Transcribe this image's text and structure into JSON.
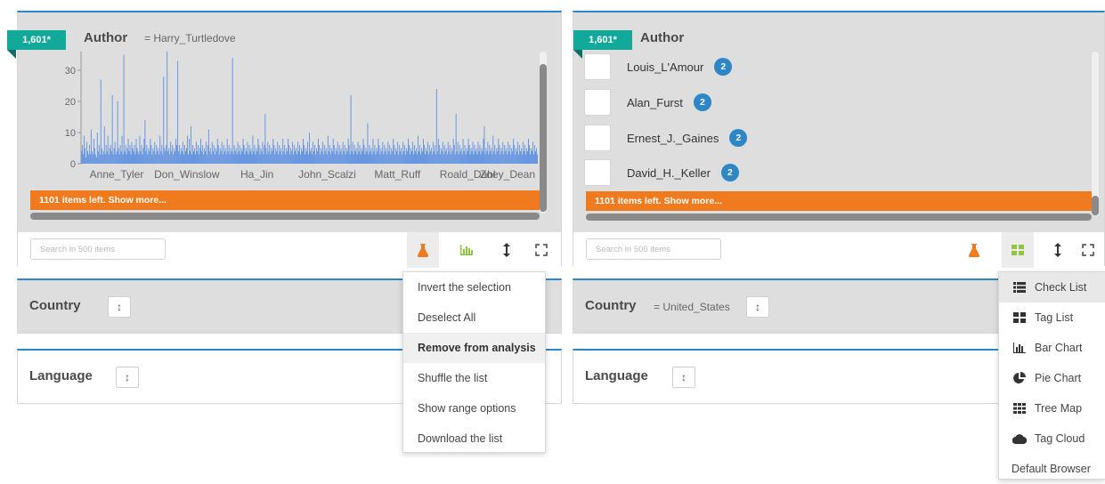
{
  "left_panel": {
    "count_badge": "1,601*",
    "title": "Author",
    "filter": "= Harry_Turtledove",
    "show_more": "1101 items left. Show more...",
    "search_placeholder": "Search in 500 items"
  },
  "right_panel": {
    "count_badge": "1,601*",
    "title": "Author",
    "items": [
      {
        "label": "Louis_L'Amour",
        "count": "2"
      },
      {
        "label": "Alan_Furst",
        "count": "2"
      },
      {
        "label": "Ernest_J._Gaines",
        "count": "2"
      },
      {
        "label": "David_H._Keller",
        "count": "2"
      }
    ],
    "show_more": "1101 items left. Show more...",
    "search_placeholder": "Search in 500 items"
  },
  "country_left": {
    "title": "Country",
    "sort_icon": "↕"
  },
  "language_left": {
    "title": "Language",
    "sort_icon": "↕"
  },
  "country_right": {
    "title": "Country",
    "filter": "= United_States",
    "sort_icon": "↕"
  },
  "language_right": {
    "title": "Language",
    "sort_icon": "↕"
  },
  "settings_menu": {
    "items": [
      "Invert the selection",
      "Deselect All",
      "Remove from analysis",
      "Shuffle the list",
      "Show range options",
      "Download the list"
    ]
  },
  "view_menu": {
    "items": [
      {
        "label": "Check List",
        "icon": "check-list-icon"
      },
      {
        "label": "Tag List",
        "icon": "tag-list-icon"
      },
      {
        "label": "Bar Chart",
        "icon": "bar-chart-icon"
      },
      {
        "label": "Pie Chart",
        "icon": "pie-chart-icon"
      },
      {
        "label": "Tree Map",
        "icon": "tree-map-icon"
      },
      {
        "label": "Tag Cloud",
        "icon": "tag-cloud-icon"
      }
    ],
    "default_label": "Default Browser"
  },
  "colors": {
    "accent": "#2d87c6",
    "teal": "#12a99a",
    "orange": "#f07a1e",
    "bar": "#5b8fe0"
  },
  "chart_data": {
    "type": "bar",
    "ylim": [
      0,
      36
    ],
    "yticks": [
      "0",
      "10",
      "20",
      "30"
    ],
    "xticks": [
      "Anne_Tyler",
      "Don_Winslow",
      "Ha_Jin",
      "John_Scalzi",
      "Matt_Ruff",
      "Roald_Dahl",
      "Zoey_Dean"
    ],
    "values": [
      4,
      6,
      3,
      9,
      5,
      2,
      7,
      4,
      3,
      6,
      3,
      11,
      4,
      3,
      8,
      5,
      3,
      2,
      10,
      4,
      6,
      3,
      27,
      5,
      3,
      4,
      12,
      3,
      6,
      4,
      9,
      3,
      5,
      6,
      4,
      22,
      3,
      5,
      7,
      3,
      4,
      20,
      5,
      3,
      6,
      4,
      9,
      3,
      35,
      4,
      6,
      3,
      5,
      8,
      4,
      6,
      3,
      7,
      5,
      4,
      6,
      3,
      8,
      5,
      4,
      3,
      9,
      4,
      6,
      3,
      5,
      8,
      14,
      4,
      6,
      3,
      5,
      4,
      8,
      6,
      3,
      5,
      4,
      7,
      3,
      6,
      4,
      5,
      3,
      9,
      4,
      6,
      3,
      28,
      5,
      4,
      6,
      36,
      4,
      5,
      3,
      7,
      4,
      6,
      3,
      5,
      4,
      8,
      6,
      33,
      4,
      6,
      3,
      5,
      4,
      7,
      3,
      6,
      4,
      5,
      9,
      3,
      8,
      4,
      12,
      3,
      6,
      4,
      5,
      3,
      7,
      4,
      6,
      3,
      5,
      8,
      4,
      6,
      3,
      5,
      4,
      7,
      3,
      6,
      11,
      4,
      5,
      3,
      7,
      4,
      6,
      3,
      5,
      4,
      8,
      6,
      3,
      5,
      4,
      7,
      3,
      6,
      4,
      5,
      3,
      8,
      4,
      6,
      3,
      5,
      4,
      34,
      3,
      6,
      4,
      5,
      3,
      7,
      4,
      6,
      3,
      5,
      4,
      8,
      6,
      3,
      5,
      4,
      7,
      3,
      6,
      4,
      5,
      3,
      9,
      4,
      6,
      3,
      5,
      4,
      8,
      6,
      3,
      5,
      4,
      7,
      3,
      6,
      16,
      5,
      3,
      7,
      4,
      6,
      3,
      5,
      4,
      8,
      6,
      3,
      5,
      4,
      7,
      3,
      6,
      4,
      5,
      3,
      8,
      4,
      6,
      3,
      5,
      4,
      8,
      6,
      3,
      5,
      4,
      7,
      3,
      6,
      4,
      5,
      3,
      7,
      4,
      6,
      3,
      5,
      4,
      8,
      6,
      3,
      5,
      4,
      7,
      3,
      10,
      4,
      5,
      3,
      7,
      4,
      6,
      3,
      5,
      4,
      8,
      6,
      3,
      5,
      4,
      7,
      3,
      6,
      4,
      5,
      3,
      9,
      4,
      6,
      3,
      5,
      4,
      8,
      6,
      3,
      5,
      4,
      7,
      3,
      6,
      4,
      5,
      3,
      7,
      4,
      6,
      3,
      5,
      4,
      8,
      6,
      3,
      22,
      4,
      7,
      3,
      6,
      4,
      5,
      3,
      7,
      4,
      6,
      3,
      5,
      4,
      8,
      6,
      3,
      5,
      4,
      13,
      3,
      6,
      4,
      5,
      3,
      8,
      4,
      6,
      3,
      5,
      4,
      8,
      6,
      3,
      5,
      4,
      7,
      3,
      6,
      4,
      5,
      3,
      7,
      4,
      6,
      3,
      5,
      4,
      8,
      6,
      3,
      5,
      4,
      7,
      3,
      6,
      4,
      5,
      3,
      7,
      4,
      6,
      3,
      5,
      4,
      8,
      6,
      3,
      5,
      4,
      7,
      3,
      6,
      4,
      5,
      3,
      9,
      4,
      6,
      3,
      5,
      4,
      8,
      6,
      3,
      5,
      4,
      7,
      3,
      6,
      4,
      5,
      3,
      7,
      4,
      6,
      3,
      24,
      4,
      8,
      6,
      3,
      5,
      4,
      7,
      3,
      6,
      4,
      5,
      3,
      7,
      4,
      6,
      3,
      5,
      4,
      8,
      6,
      3,
      16,
      4,
      7,
      3,
      6,
      4,
      5,
      3,
      8,
      4,
      6,
      3,
      5,
      4,
      8,
      6,
      3,
      5,
      4,
      7,
      3,
      6,
      4,
      5,
      3,
      7,
      4,
      6,
      3,
      5,
      4,
      8,
      12,
      3,
      5,
      4,
      7,
      3,
      6,
      4,
      5,
      3,
      9,
      4,
      6,
      3,
      5,
      4,
      8,
      6,
      3,
      5,
      4,
      7,
      3,
      6,
      4,
      5,
      3,
      7,
      4,
      6,
      3,
      5,
      4,
      8,
      6,
      3,
      5,
      4,
      7,
      3,
      6,
      4,
      5,
      3,
      7,
      4,
      6,
      3,
      5,
      4,
      8,
      6,
      3,
      5,
      4,
      7,
      3,
      6,
      4,
      5,
      3
    ]
  }
}
